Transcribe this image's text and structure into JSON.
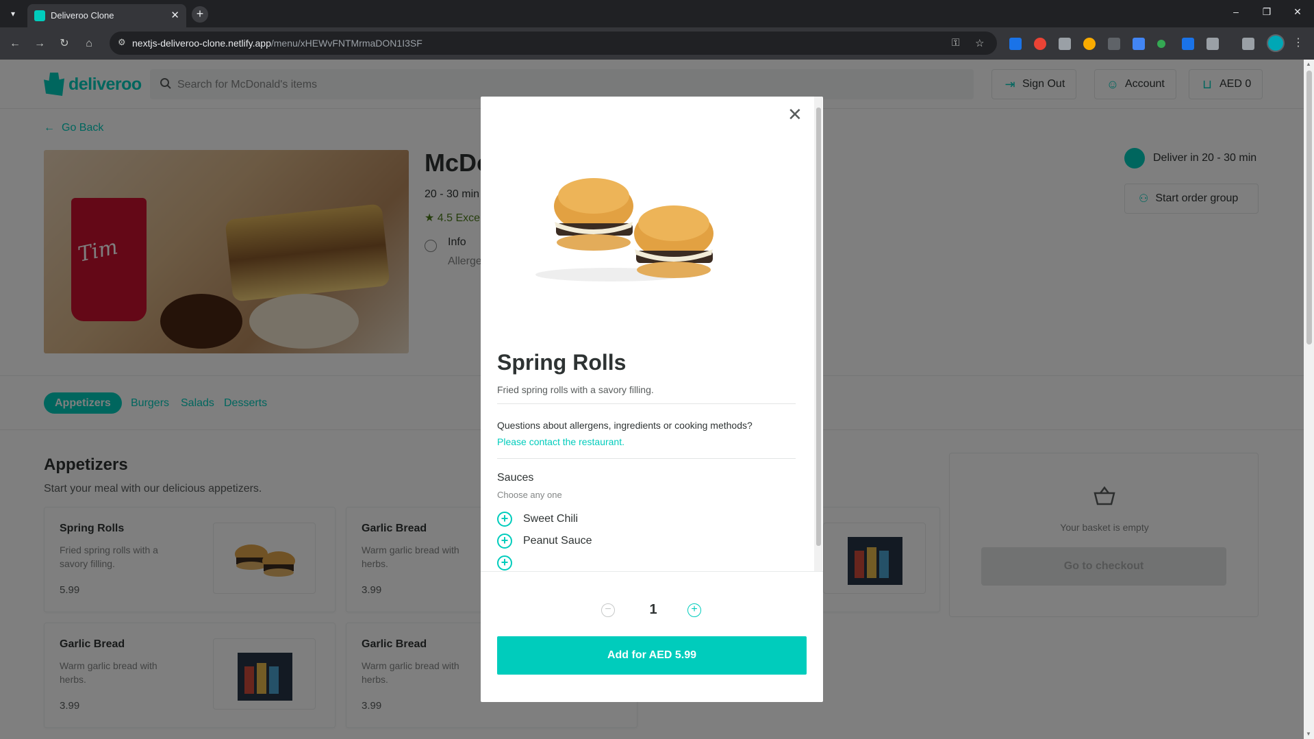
{
  "browser": {
    "tab_title": "Deliveroo Clone",
    "url_host": "nextjs-deliveroo-clone.netlify.app",
    "url_path": "/menu/xHEWvFNTMrmaDON1I3SF"
  },
  "header": {
    "logo_text": "deliveroo",
    "search_placeholder": "Search for McDonald's items",
    "sign_out": "Sign Out",
    "account": "Account",
    "basket": "AED 0"
  },
  "restaurant": {
    "go_back": "Go Back",
    "name": "McDonald's",
    "delivery_time": "20 - 30 min",
    "rating": "4.5 Excellent",
    "info_label": "Info",
    "info_sub": "Allergens",
    "deliver": "Deliver in 20 - 30 min",
    "order_group": "Start order group"
  },
  "categories": [
    "Appetizers",
    "Burgers",
    "Salads",
    "Desserts"
  ],
  "section": {
    "title": "Appetizers",
    "subtitle": "Start your meal with our delicious appetizers."
  },
  "menu_items": [
    {
      "name": "Spring Rolls",
      "desc": "Fried spring rolls with a savory filling.",
      "price": "5.99"
    },
    {
      "name": "Garlic Bread",
      "desc": "Warm garlic bread with herbs.",
      "price": "3.99"
    },
    {
      "name": "Garlic Bread",
      "desc": "Warm garlic bread with herbs.",
      "price": "3.99"
    },
    {
      "name": "Garlic Bread",
      "desc": "Warm garlic bread with herbs.",
      "price": "3.99"
    }
  ],
  "basket": {
    "empty_text": "Your basket is empty",
    "checkout": "Go to checkout"
  },
  "modal": {
    "title": "Spring Rolls",
    "description": "Fried spring rolls with a savory filling.",
    "question": "Questions about allergens, ingredients or cooking methods?",
    "contact": "Please contact the restaurant.",
    "group_title": "Sauces",
    "group_hint": "Choose any one",
    "options": [
      "Sweet Chili",
      "Peanut Sauce"
    ],
    "quantity": "1",
    "add_button": "Add for AED 5.99"
  },
  "colors": {
    "accent": "#00ccbc",
    "text": "#2e3333"
  }
}
